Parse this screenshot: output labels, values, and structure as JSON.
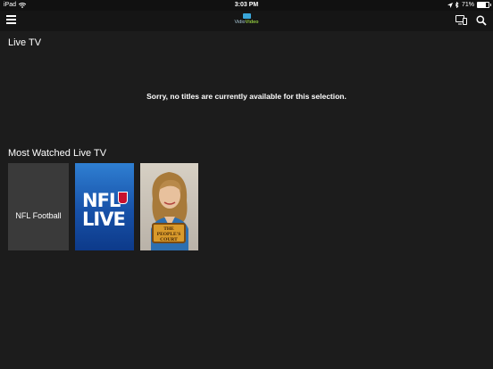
{
  "status_bar": {
    "device": "iPad",
    "time": "3:03 PM",
    "battery": "71%",
    "battery_level": 0.71
  },
  "nav": {
    "logo_part1": "Vidio",
    "logo_part2": "Video"
  },
  "live_tv": {
    "title": "Live TV",
    "empty_message": "Sorry, no titles are currently available for this selection."
  },
  "most_watched": {
    "title": "Most Watched Live TV",
    "tiles": [
      {
        "label": "NFL Football"
      },
      {
        "line1": "NFL",
        "line2": "LIVE"
      },
      {
        "badge_line1": "THE",
        "badge_line2": "PEOPLE'S",
        "badge_line3": "COURT"
      }
    ]
  },
  "colors": {
    "background": "#1c1c1c",
    "nav_background": "#151515",
    "accent_blue": "#3aa6d9",
    "accent_green": "#8fc63f"
  }
}
